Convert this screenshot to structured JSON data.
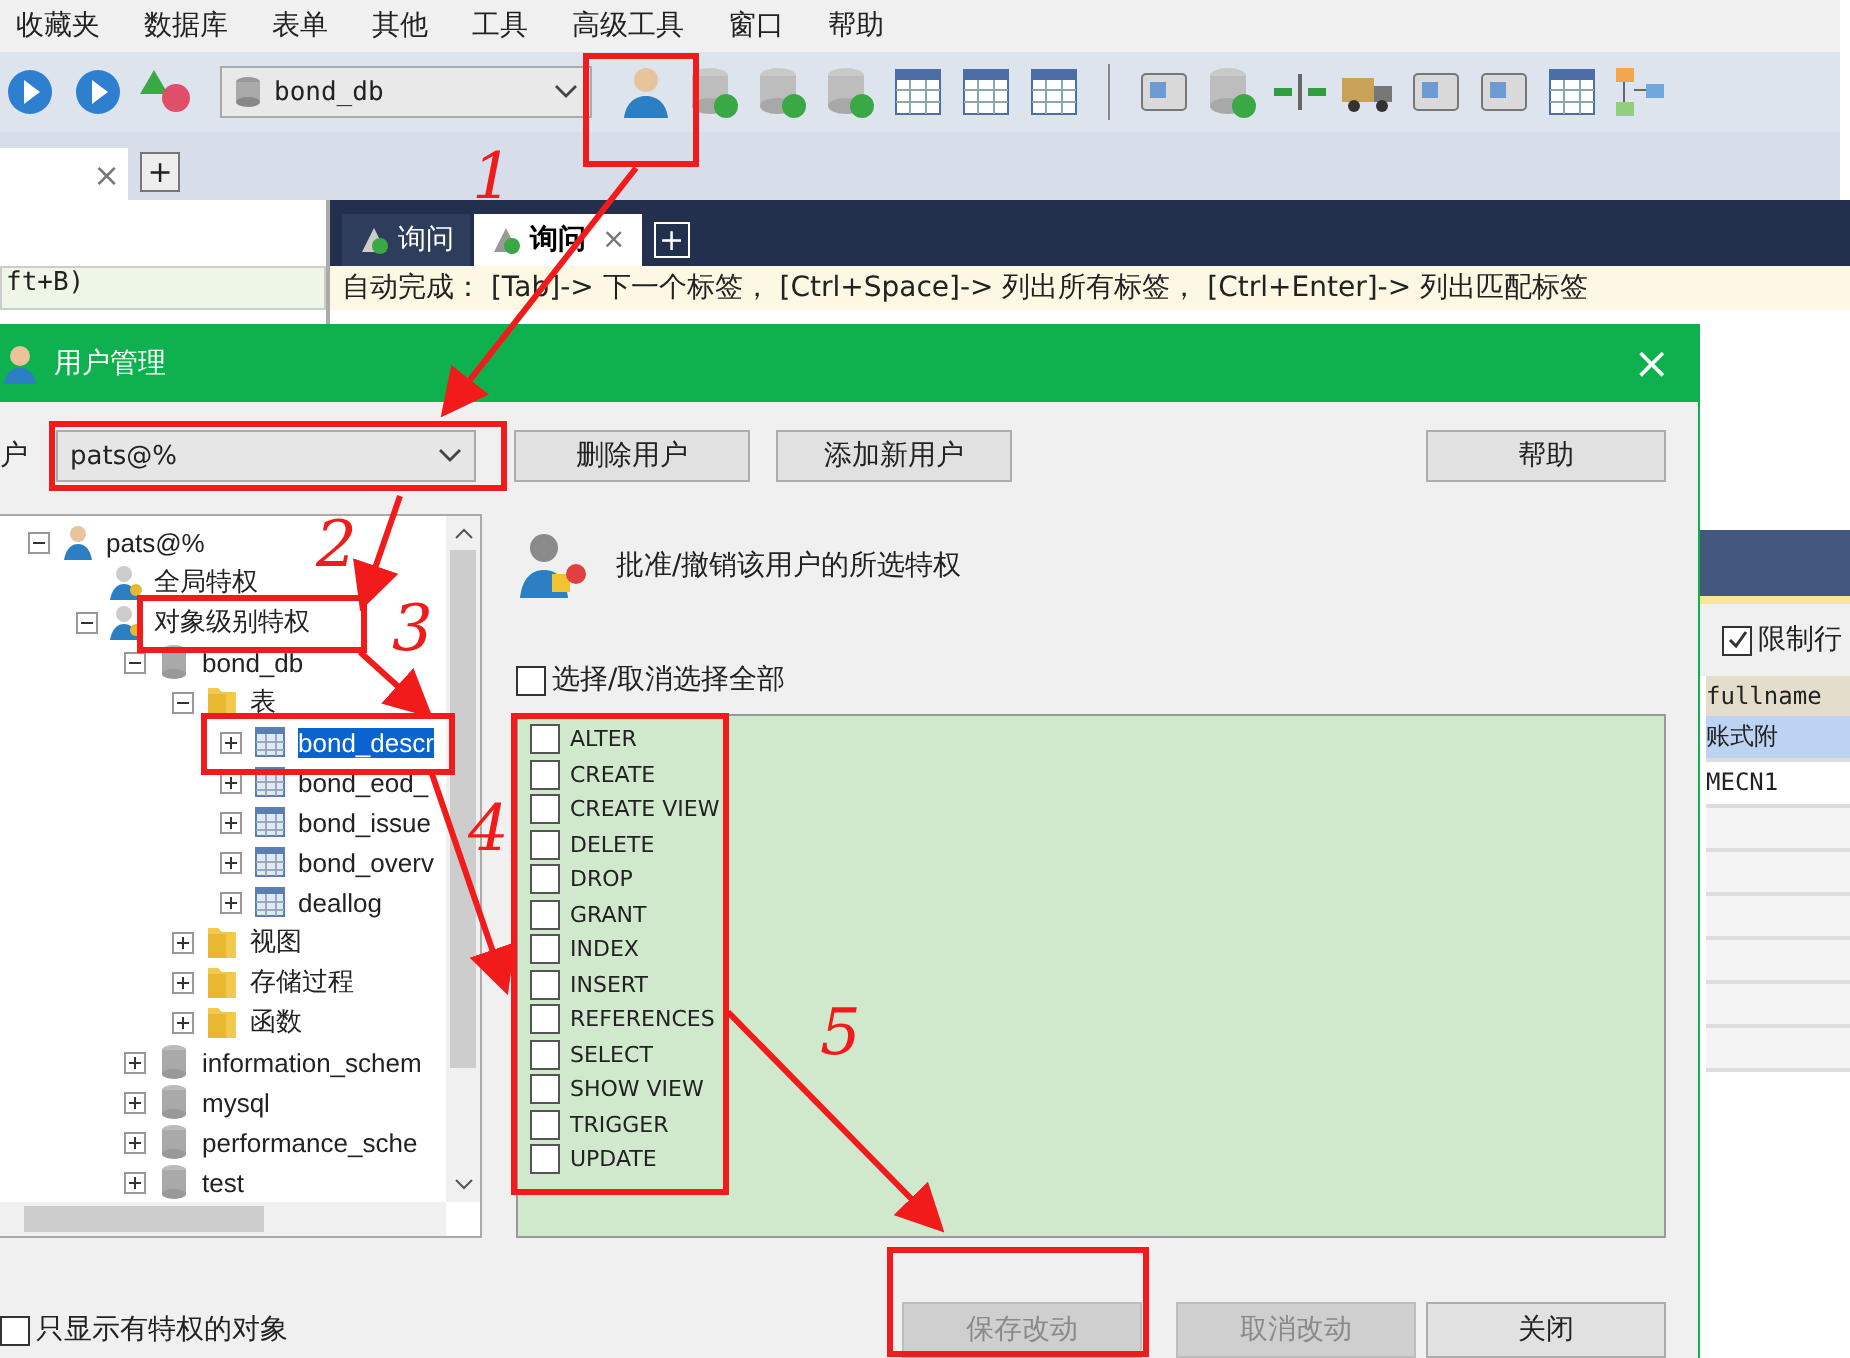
{
  "menu": [
    "收藏夹",
    "数据库",
    "表单",
    "其他",
    "工具",
    "高级工具",
    "窗口",
    "帮助"
  ],
  "toolbar": {
    "database": "bond_db"
  },
  "left_panel": {
    "tab_close": "×",
    "tab_add": "+",
    "shortcut_field": "ft+B)"
  },
  "editor": {
    "tabs": [
      {
        "label": "询问",
        "selected": false
      },
      {
        "label": "询问",
        "selected": true,
        "close": "×"
      }
    ],
    "tab_add": "+",
    "hint": "自动完成： [Tab]-> 下一个标签， [Ctrl+Space]-> 列出所有标签， [Ctrl+Enter]-> 列出匹配标签"
  },
  "results": {
    "limit_rows": {
      "label": "限制行",
      "checked": true
    },
    "column": "fullname",
    "rows": [
      {
        "text": "账式附",
        "selected": true
      },
      {
        "text": "MECN1",
        "selected": false
      }
    ]
  },
  "dialog": {
    "title": "用户管理",
    "close": "×",
    "user_label": "户",
    "user": "pats@%",
    "buttons": [
      "删除用户",
      "添加新用户",
      "帮助"
    ],
    "tree": [
      {
        "label": "pats@%",
        "kind": "user",
        "expanded": true,
        "children": [
          {
            "label": "全局特权",
            "kind": "privilege"
          },
          {
            "label": "对象级别特权",
            "kind": "privilege",
            "expanded": true,
            "children": [
              {
                "label": "bond_db",
                "kind": "database",
                "expanded": true,
                "children": [
                  {
                    "label": "表",
                    "kind": "folder",
                    "expanded": true,
                    "children": [
                      {
                        "label": "bond_descr",
                        "kind": "table",
                        "expanded": false,
                        "selected": true
                      },
                      {
                        "label": "bond_eod_",
                        "kind": "table",
                        "expanded": false,
                        "selected": false
                      },
                      {
                        "label": "bond_issue",
                        "kind": "table",
                        "expanded": false,
                        "selected": false
                      },
                      {
                        "label": "bond_overv",
                        "kind": "table",
                        "expanded": false,
                        "selected": false
                      },
                      {
                        "label": "deallog",
                        "kind": "table",
                        "expanded": false,
                        "selected": false
                      }
                    ]
                  },
                  {
                    "label": "视图",
                    "kind": "folder",
                    "expanded": false
                  },
                  {
                    "label": "存储过程",
                    "kind": "folder",
                    "expanded": false
                  },
                  {
                    "label": "函数",
                    "kind": "folder",
                    "expanded": false
                  }
                ]
              },
              {
                "label": "information_schem",
                "kind": "database",
                "expanded": false
              },
              {
                "label": "mysql",
                "kind": "database",
                "expanded": false
              },
              {
                "label": "performance_sche",
                "kind": "database",
                "expanded": false
              },
              {
                "label": "test",
                "kind": "database",
                "expanded": false
              }
            ]
          }
        ]
      }
    ],
    "heading": "批准/撤销该用户的所选特权",
    "select_all": {
      "label": "选择/取消选择全部",
      "checked": false
    },
    "privileges": [
      {
        "label": "ALTER",
        "checked": false
      },
      {
        "label": "CREATE",
        "checked": false
      },
      {
        "label": "CREATE VIEW",
        "checked": false
      },
      {
        "label": "DELETE",
        "checked": false
      },
      {
        "label": "DROP",
        "checked": false
      },
      {
        "label": "GRANT",
        "checked": false
      },
      {
        "label": "INDEX",
        "checked": false
      },
      {
        "label": "INSERT",
        "checked": false
      },
      {
        "label": "REFERENCES",
        "checked": false
      },
      {
        "label": "SELECT",
        "checked": false
      },
      {
        "label": "SHOW VIEW",
        "checked": false
      },
      {
        "label": "TRIGGER",
        "checked": false
      },
      {
        "label": "UPDATE",
        "checked": false
      }
    ],
    "only_privileged": {
      "label": "只显示有特权的对象",
      "checked": false
    },
    "footer_buttons": [
      {
        "label": "保存改动",
        "disabled": true
      },
      {
        "label": "取消改动",
        "disabled": true
      },
      {
        "label": "关闭",
        "disabled": false
      }
    ]
  },
  "step_numbers": [
    "1",
    "2",
    "3",
    "4",
    "5"
  ]
}
